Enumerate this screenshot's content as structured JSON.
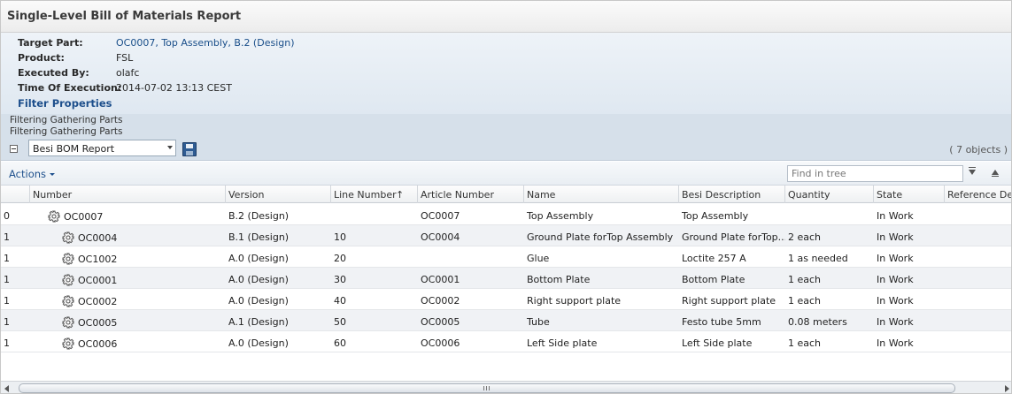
{
  "report": {
    "title": "Single-Level Bill of Materials Report"
  },
  "properties": [
    {
      "label": "Target Part:",
      "value": "OC0007, Top Assembly, B.2 (Design)",
      "link": true
    },
    {
      "label": "Product:",
      "value": "FSL",
      "link": false
    },
    {
      "label": "Executed By:",
      "value": "olafc",
      "link": false
    },
    {
      "label": "Time Of Execution:",
      "value": "2014-07-02 13:13 CEST",
      "link": false
    }
  ],
  "filter_properties_label": "Filter Properties",
  "filter_lines": [
    "Filtering Gathering Parts",
    "Filtering Gathering Parts"
  ],
  "report_select": {
    "value": "Besi BOM Report"
  },
  "object_count": "( 7 objects )",
  "toolbar": {
    "actions_label": "Actions",
    "find_placeholder": "Find in tree"
  },
  "columns": [
    {
      "key": "level",
      "label": ""
    },
    {
      "key": "number",
      "label": "Number"
    },
    {
      "key": "version",
      "label": "Version"
    },
    {
      "key": "line",
      "label": "Line Number",
      "sorted": "asc",
      "sort_glyph": "↑"
    },
    {
      "key": "article",
      "label": "Article Number"
    },
    {
      "key": "name",
      "label": "Name"
    },
    {
      "key": "desc",
      "label": "Besi Description"
    },
    {
      "key": "qty",
      "label": "Quantity"
    },
    {
      "key": "state",
      "label": "State"
    },
    {
      "key": "refdes",
      "label": "Reference Des"
    }
  ],
  "rows": [
    {
      "level": "0",
      "number": "OC0007",
      "depth": 0,
      "version": "B.2 (Design)",
      "line": "",
      "article": "OC0007",
      "name": "Top Assembly",
      "desc": "Top Assembly",
      "qty": "",
      "state": "In Work",
      "refdes": ""
    },
    {
      "level": "1",
      "number": "OC0004",
      "depth": 1,
      "version": "B.1 (Design)",
      "line": "10",
      "article": "OC0004",
      "name": "Ground Plate forTop Assembly",
      "desc": "Ground Plate forTop...",
      "qty": "2 each",
      "state": "In Work",
      "refdes": ""
    },
    {
      "level": "1",
      "number": "OC1002",
      "depth": 1,
      "version": "A.0 (Design)",
      "line": "20",
      "article": "",
      "name": "Glue",
      "desc": "Loctite 257 A",
      "qty": "1 as needed",
      "state": "In Work",
      "refdes": ""
    },
    {
      "level": "1",
      "number": "OC0001",
      "depth": 1,
      "version": "A.0 (Design)",
      "line": "30",
      "article": "OC0001",
      "name": "Bottom Plate",
      "desc": "Bottom Plate",
      "qty": "1 each",
      "state": "In Work",
      "refdes": ""
    },
    {
      "level": "1",
      "number": "OC0002",
      "depth": 1,
      "version": "A.0 (Design)",
      "line": "40",
      "article": "OC0002",
      "name": "Right support plate",
      "desc": "Right support plate",
      "qty": "1 each",
      "state": "In Work",
      "refdes": ""
    },
    {
      "level": "1",
      "number": "OC0005",
      "depth": 1,
      "version": "A.1 (Design)",
      "line": "50",
      "article": "OC0005",
      "name": "Tube",
      "desc": "Festo tube 5mm",
      "qty": "0.08 meters",
      "state": "In Work",
      "refdes": ""
    },
    {
      "level": "1",
      "number": "OC0006",
      "depth": 1,
      "version": "A.0 (Design)",
      "line": "60",
      "article": "OC0006",
      "name": "Left Side plate",
      "desc": "Left Side plate",
      "qty": "1 each",
      "state": "In Work",
      "refdes": ""
    }
  ],
  "icons": {
    "part": "gear-icon",
    "collapse": "minus-box-icon",
    "save": "floppy-disk-icon",
    "filter": "funnel-icon",
    "clear_filter": "funnel-clear-icon"
  }
}
